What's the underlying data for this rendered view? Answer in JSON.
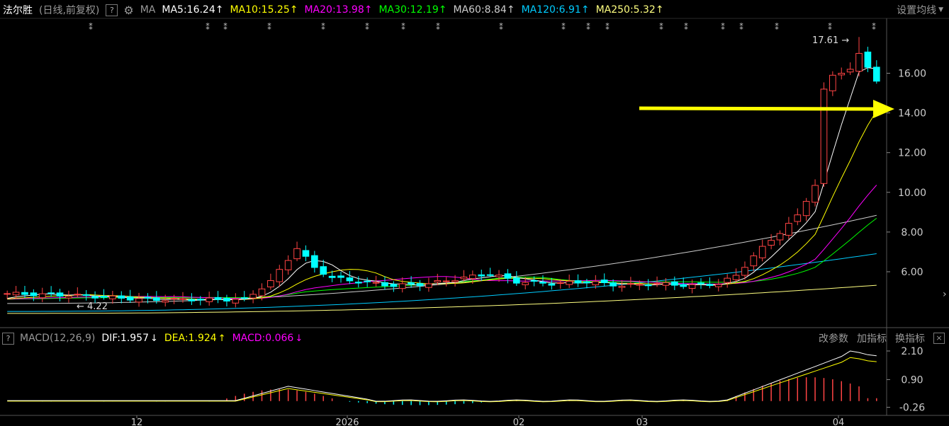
{
  "header": {
    "stock_name": "法尔胜",
    "period_adjust": "(日线,前复权)",
    "help_label": "?",
    "indicator_group": "MA",
    "ma": [
      {
        "label": "MA5:16.24",
        "color": "#ffffff"
      },
      {
        "label": "MA10:15.25",
        "color": "#ffff00"
      },
      {
        "label": "MA20:13.98",
        "color": "#ff00ff"
      },
      {
        "label": "MA30:12.19",
        "color": "#00ff00"
      },
      {
        "label": "MA60:8.84",
        "color": "#cccccc"
      },
      {
        "label": "MA120:6.91",
        "color": "#00ccff"
      },
      {
        "label": "MA250:5.32",
        "color": "#ffff80"
      }
    ],
    "ma_arrow": "↑",
    "settings_label": "设置均线"
  },
  "macd_header": {
    "help_label": "?",
    "title": "MACD(12,26,9)",
    "dif": "DIF:1.957",
    "dif_arrow": "↓",
    "dea": "DEA:1.924",
    "dea_arrow": "↑",
    "macd": "MACD:0.066",
    "macd_arrow": "↓",
    "tools": [
      "改参数",
      "加指标",
      "换指标"
    ],
    "close_label": "×"
  },
  "chart_data": {
    "type": "candlestick",
    "price_axis": {
      "ticks": [
        "16.00",
        "14.00",
        "12.00",
        "10.00",
        "8.00",
        "6.00"
      ],
      "ylim": [
        4.0,
        17.9
      ]
    },
    "macd_axis": {
      "ticks": [
        "2.10",
        "0.90",
        "-0.26"
      ],
      "ylim": [
        -0.26,
        2.35
      ]
    },
    "x_labels": [
      "12",
      "2026",
      "02",
      "03",
      "04"
    ],
    "annotations": {
      "high": "17.61",
      "low": "4.22"
    },
    "colors": {
      "up": "#ff4444",
      "down": "#00ffff",
      "ma5": "#ffffff",
      "ma10": "#ffff00",
      "ma20": "#ff00ff",
      "ma30": "#00ff00",
      "ma60": "#cccccc",
      "ma120": "#00ccff",
      "ma250": "#ffff80",
      "arrow": "#ffff00"
    }
  }
}
